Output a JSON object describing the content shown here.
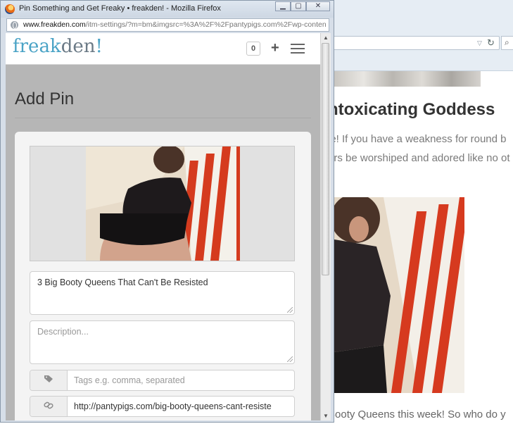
{
  "popup": {
    "window_title": "Pin Something and Get Freaky • freakden! - Mozilla Firefox",
    "url_host": "www.freakden.com",
    "url_path": "/itm-settings/?m=bm&imgsrc=%3A%2F%2Fpantypigs.com%2Fwp-conten"
  },
  "site": {
    "logo_freak": "freak",
    "logo_den": "den",
    "logo_bang": "!",
    "pin_count": "0",
    "add_icon": "+"
  },
  "form": {
    "page_title": "Add Pin",
    "title_value": "3 Big Booty Queens That Can't Be Resisted",
    "description_placeholder": "Description...",
    "tags_placeholder": "Tags e.g. comma, separated",
    "link_value": "http://pantypigs.com/big-booty-queens-cant-resiste"
  },
  "background_page": {
    "heading": "ntoxicating Goddess",
    "para_line1": "le! If you have a weakness for round b",
    "para_line2": "ers be worshiped and adored like no ot",
    "para_line3": " Booty Queens this week! So who do y"
  },
  "icons": {
    "tag": "tag-icon",
    "link": "link-icon",
    "menu": "hamburger-menu-icon",
    "globe": "globe-icon"
  }
}
